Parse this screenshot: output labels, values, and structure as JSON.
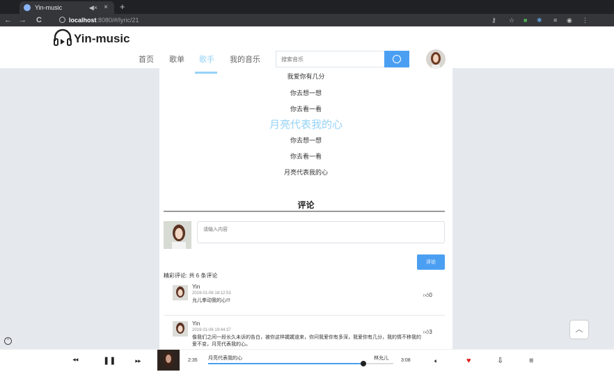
{
  "browser": {
    "tab_title": "Yin-music",
    "tab_audio": "◀×",
    "tab_close": "×",
    "new_tab": "+",
    "url_host": "localhost",
    "url_rest": ":8080/#/lyric/21"
  },
  "header": {
    "logo": "Yin-music",
    "nav": [
      "首页",
      "歌单",
      "歌手",
      "我的音乐"
    ],
    "active_nav_index": 2,
    "search_placeholder": "搜索音乐"
  },
  "lyrics": {
    "before": [
      "我爱你有几分",
      "你去想一想",
      "你去看一看"
    ],
    "current": "月亮代表我的心",
    "after": [
      "你去想一想",
      "你去看一看",
      "月亮代表我的心"
    ]
  },
  "comments": {
    "title": "评论",
    "input_placeholder": "请输入内容",
    "submit_label": "评论",
    "count_text": "精彩评论: 共 6 条评论",
    "items": [
      {
        "user": "Yin",
        "time": "2019-01-06 18:12:53",
        "text": "允儿拳动我的心!!!",
        "likes": "0"
      },
      {
        "user": "Yin",
        "time": "2019-01-06 19:44:37",
        "text": "像我们之间一段长久未诉的告白，被你这样娓娓道来，你问我爱你有多深，我爱你有几分，我的情不移我的爱不变，月亮代表我的心。",
        "likes": "3"
      }
    ]
  },
  "player": {
    "current_time": "2:35",
    "duration": "3:08",
    "song": "月亮代表我的心",
    "artist": "林允儿",
    "progress": 0.84
  },
  "colors": {
    "accent": "#95d2f6",
    "primary_button": "#4b9ff2",
    "side_background": "#e5e9ee",
    "like_heart": "#e02020"
  }
}
